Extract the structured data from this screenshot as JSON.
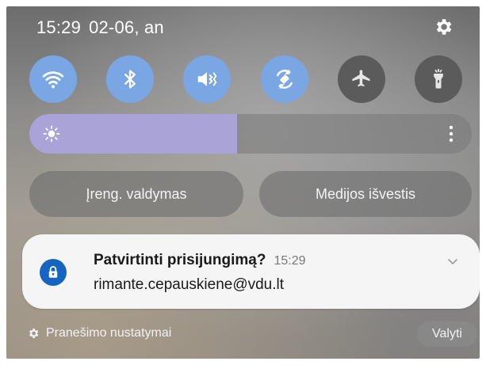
{
  "status_bar": {
    "time": "15:29",
    "date": "02-06, an"
  },
  "quick_toggles": [
    {
      "icon": "wifi-icon",
      "state": "on"
    },
    {
      "icon": "bluetooth-icon",
      "state": "on"
    },
    {
      "icon": "sound-mute-icon",
      "state": "on"
    },
    {
      "icon": "auto-rotate-icon",
      "state": "on"
    },
    {
      "icon": "airplane-icon",
      "state": "off"
    },
    {
      "icon": "flashlight-icon",
      "state": "off"
    }
  ],
  "brightness": {
    "level_fraction": 0.47
  },
  "buttons": {
    "device_control": "Įreng. valdymas",
    "media_output": "Medijos išvestis"
  },
  "notification": {
    "title": "Patvirtinti prisijungimą?",
    "time": "15:29",
    "text": "rimante.cepauskiene@vdu.lt"
  },
  "footer": {
    "settings_label": "Pranešimo nustatymai",
    "clear_label": "Valyti"
  },
  "colors": {
    "toggle_on": "#7aa7e3",
    "toggle_off": "#5b5b5b",
    "brightness_fill": "#a9a3d8",
    "app_icon": "#1565c0"
  }
}
